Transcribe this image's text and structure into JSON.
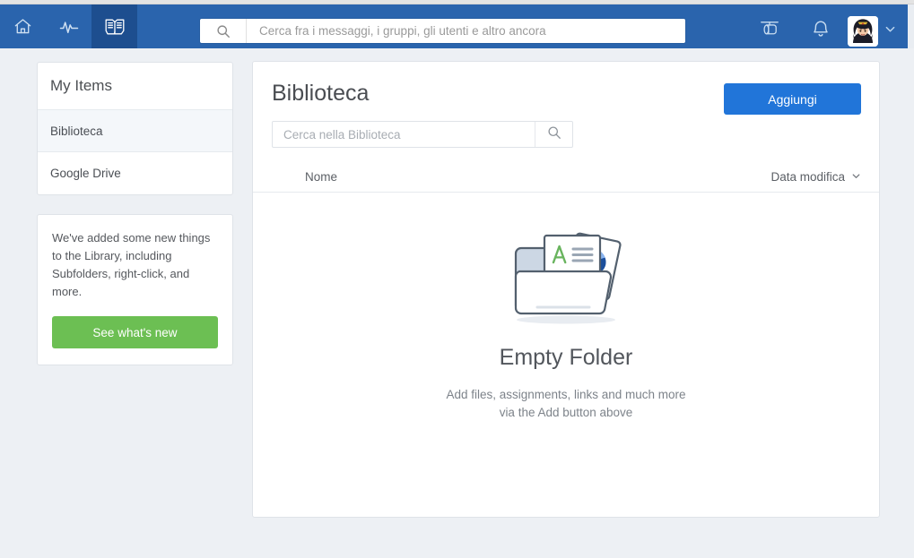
{
  "topbar": {
    "tabs": [
      {
        "name": "home",
        "icon": "home-icon",
        "active": false
      },
      {
        "name": "activity",
        "icon": "pulse-icon",
        "active": false
      },
      {
        "name": "library",
        "icon": "book-icon",
        "active": true
      }
    ],
    "search": {
      "placeholder": "Cerca fra i messaggi, i gruppi, gli utenti e altro ancora",
      "value": "",
      "icon": "search-icon"
    },
    "actions": [
      {
        "name": "spotlight",
        "icon": "cable-car-icon"
      },
      {
        "name": "notifications",
        "icon": "bell-icon"
      }
    ],
    "account": {
      "avatar_label": "user-avatar",
      "chevron": "chevron-down-icon"
    },
    "colors": {
      "bar": "#2a64ad",
      "active_tab": "#1d4e8f"
    }
  },
  "sidebar": {
    "header": "My Items",
    "items": [
      {
        "label": "Biblioteca",
        "selected": true
      },
      {
        "label": "Google Drive",
        "selected": false
      }
    ],
    "promo": {
      "text": "We've added some new things to the Library, including Subfolders, right-click, and more.",
      "button": "See what's new",
      "button_color": "#6cbf53"
    }
  },
  "main": {
    "title": "Biblioteca",
    "add_button": "Aggiungi",
    "add_button_color": "#2175d9",
    "search": {
      "placeholder": "Cerca nella Biblioteca",
      "value": "",
      "icon": "search-icon"
    },
    "table": {
      "col_name": "Nome",
      "col_sort": "Data modifica",
      "sort_icon": "chevron-down-icon",
      "rows": []
    },
    "empty_state": {
      "illustration": "empty-folder-illustration",
      "title": "Empty Folder",
      "subtitle_line1": "Add files, assignments, links and much more",
      "subtitle_line2": "via the Add button above"
    }
  }
}
